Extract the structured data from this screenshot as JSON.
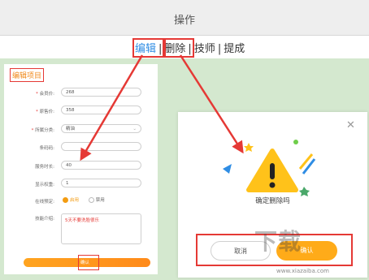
{
  "header": {
    "title": "操作"
  },
  "tabs": [
    {
      "label": "编辑",
      "active": true
    },
    {
      "label": "删除",
      "active": false
    },
    {
      "label": "技师",
      "active": false
    },
    {
      "label": "提成",
      "active": false
    }
  ],
  "edit_form": {
    "title": "编辑项目",
    "fields": {
      "price": {
        "label": "会员价:",
        "value": "268"
      },
      "market_price": {
        "label": "原售价:",
        "value": "358"
      },
      "category": {
        "label": "所属分类:",
        "value": "精油"
      },
      "barcode": {
        "label": "条码码:",
        "value": ""
      },
      "duration": {
        "label": "服务时长:",
        "value": "40"
      },
      "weight": {
        "label": "显示权重:",
        "value": "1"
      },
      "online_booking": {
        "label": "在线预定:",
        "options": [
          "启用",
          "禁用"
        ],
        "selected": "启用"
      },
      "intro": {
        "label": "技能介绍:",
        "value": "5天不要洗脸很乐"
      }
    },
    "confirm_label": "确认"
  },
  "dialog": {
    "message": "确定删除吗",
    "cancel_label": "取消",
    "confirm_label": "确认"
  },
  "watermark": {
    "text": "下载",
    "sub": "www.xiazaiba.com"
  },
  "colors": {
    "accent": "#ffab19",
    "annotation": "#e53935",
    "tab_active": "#2f8de4",
    "background": "#d4e8cf"
  }
}
